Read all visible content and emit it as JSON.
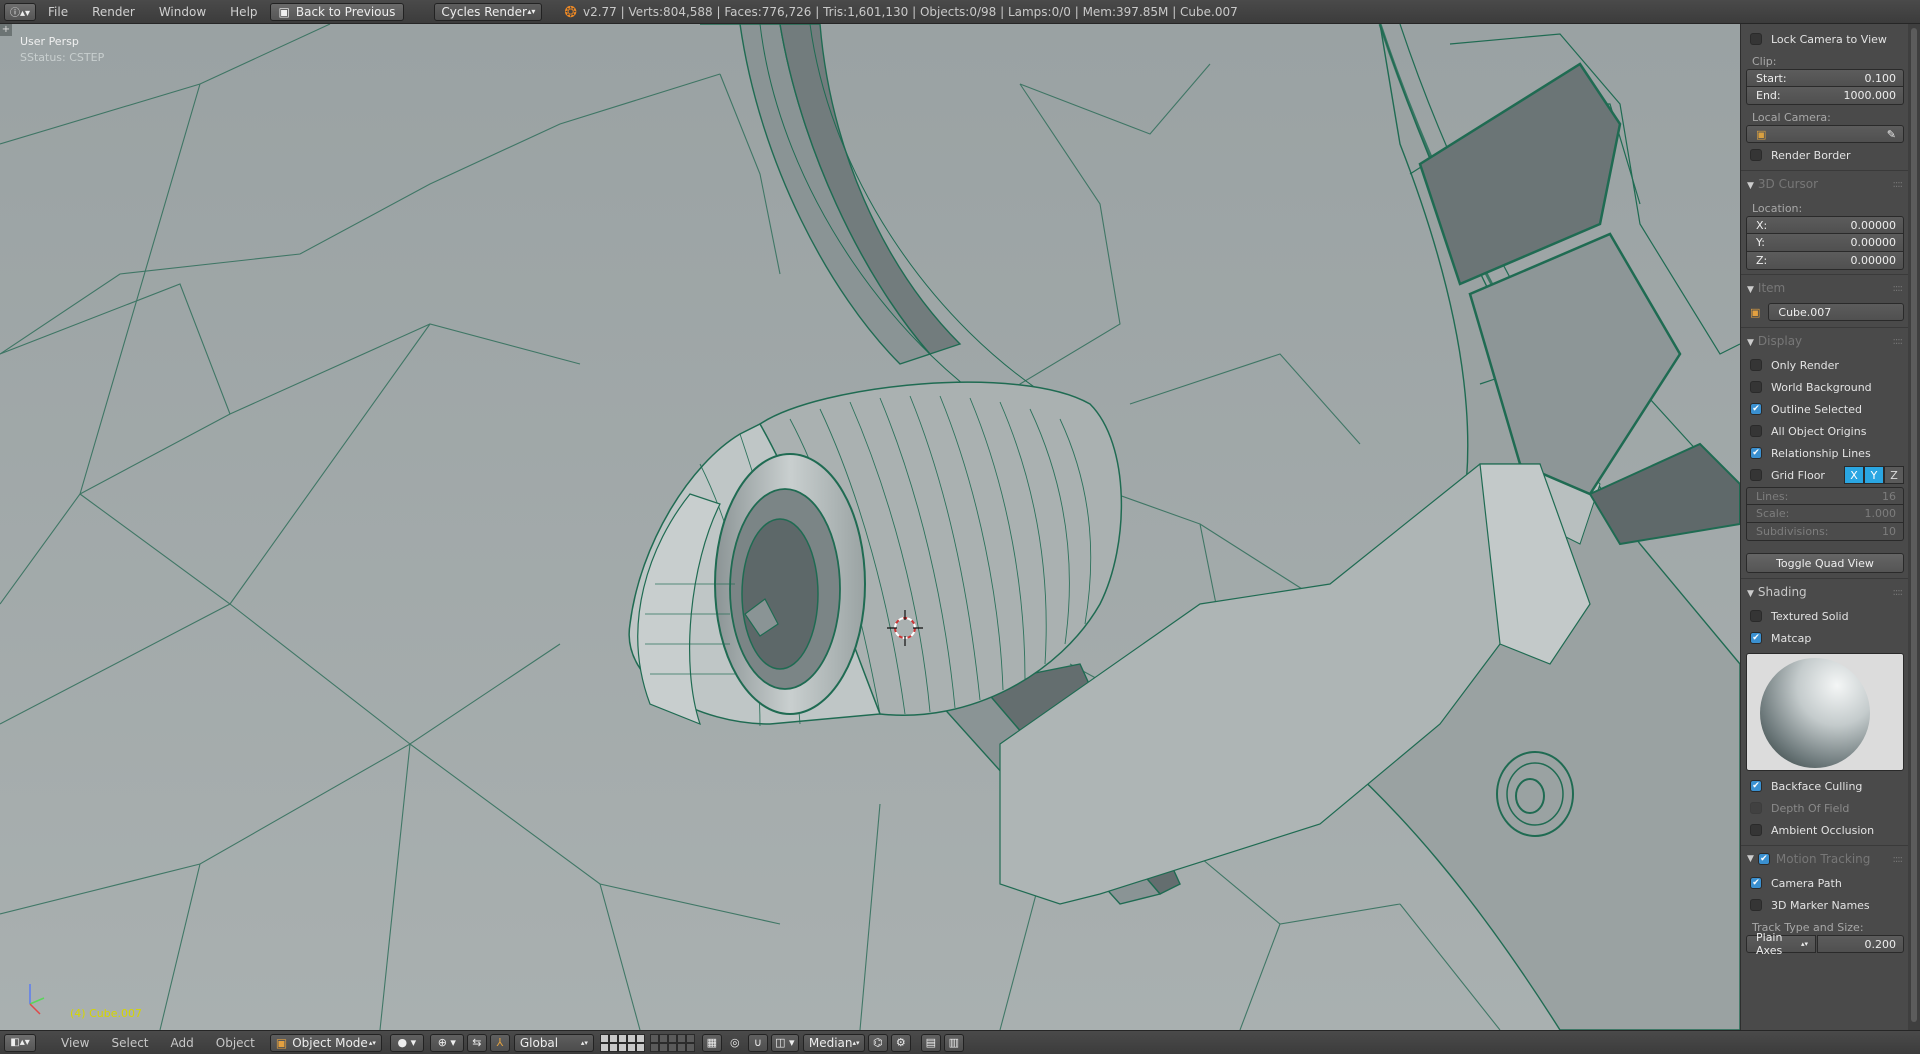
{
  "topbar": {
    "menus": [
      "File",
      "Render",
      "Window",
      "Help"
    ],
    "back_button": "Back to Previous",
    "engine": "Cycles Render",
    "stats": "v2.77 | Verts:804,588 | Faces:776,726 | Tris:1,601,130 | Objects:0/98 | Lamps:0/0 | Mem:397.85M | Cube.007"
  },
  "viewport": {
    "view_name": "User Persp",
    "status_line": "SStatus: CSTEP",
    "object_label": "(4) Cube.007"
  },
  "panel": {
    "lock_camera": "Lock Camera to View",
    "clip_label": "Clip:",
    "clip_start_label": "Start:",
    "clip_start": "0.100",
    "clip_end_label": "End:",
    "clip_end": "1000.000",
    "local_camera_label": "Local Camera:",
    "render_border": "Render Border",
    "cursor_section": "3D Cursor",
    "location_label": "Location:",
    "x_label": "X:",
    "x": "0.00000",
    "y_label": "Y:",
    "y": "0.00000",
    "z_label": "Z:",
    "z": "0.00000",
    "item_section": "Item",
    "item_name": "Cube.007",
    "display_section": "Display",
    "only_render": "Only Render",
    "world_background": "World Background",
    "outline_selected": "Outline Selected",
    "all_object_origins": "All Object Origins",
    "relationship_lines": "Relationship Lines",
    "grid_floor": "Grid Floor",
    "axis_x": "X",
    "axis_y": "Y",
    "axis_z": "Z",
    "lines_label": "Lines:",
    "lines": "16",
    "scale_label": "Scale:",
    "scale": "1.000",
    "subdivisions_label": "Subdivisions:",
    "subdivisions": "10",
    "toggle_quad_view": "Toggle Quad View",
    "shading_section": "Shading",
    "textured_solid": "Textured Solid",
    "matcap": "Matcap",
    "backface_culling": "Backface Culling",
    "depth_of_field": "Depth Of Field",
    "ambient_occlusion": "Ambient Occlusion",
    "motion_tracking_section": "Motion Tracking",
    "camera_path": "Camera Path",
    "marker_names": "3D Marker Names",
    "track_type_label": "Track Type and Size:",
    "track_type": "Plain Axes",
    "track_size": "0.200"
  },
  "bottombar": {
    "menus": [
      "View",
      "Select",
      "Add",
      "Object"
    ],
    "mode": "Object Mode",
    "orientation": "Global",
    "pivot": "Median"
  },
  "colors": {
    "viewport_bg": "#a3aaab",
    "wire": "#1f6b52",
    "checkbox_on": "#3a90d0",
    "axis_on": "#2aa6e2",
    "object_label": "#d6d600"
  }
}
